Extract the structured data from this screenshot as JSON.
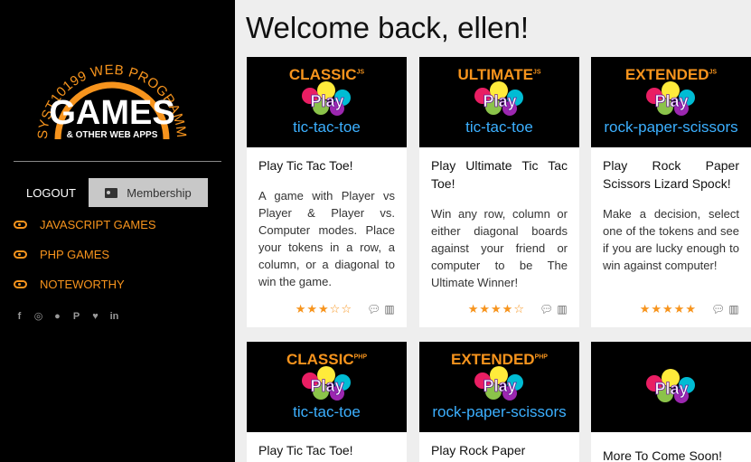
{
  "sidebar": {
    "logo": {
      "arc_text": "SYST10199 WEB PROGRAMMING",
      "title": "GAMES",
      "subtitle": "& OTHER WEB APPS"
    },
    "logout_label": "LOGOUT",
    "membership_label": "Membership",
    "nav": [
      {
        "label": "JAVASCRIPT GAMES",
        "icon": "gamepad-icon"
      },
      {
        "label": "PHP GAMES",
        "icon": "gamepad-icon"
      },
      {
        "label": "NOTEWORTHY",
        "icon": "gamepad-icon"
      }
    ],
    "social": [
      {
        "icon": "facebook-icon",
        "glyph": "f"
      },
      {
        "icon": "instagram-icon",
        "glyph": "◎"
      },
      {
        "icon": "snapchat-icon",
        "glyph": "●"
      },
      {
        "icon": "pinterest-icon",
        "glyph": "P"
      },
      {
        "icon": "twitter-icon",
        "glyph": "♥"
      },
      {
        "icon": "linkedin-icon",
        "glyph": "in"
      }
    ]
  },
  "main": {
    "welcome": "Welcome back, ellen!",
    "cards": [
      {
        "edition": "CLASSIC",
        "edition_sup": "JS",
        "subtitle": "tic-tac-toe",
        "title": "Play Tic Tac Toe!",
        "text": "A game with Player vs Player & Player vs. Computer modes. Place your tokens in a row, a column, or a diagonal to win the game.",
        "rating": 3.5,
        "stars": "★★★☆☆"
      },
      {
        "edition": "ULTIMATE",
        "edition_sup": "JS",
        "subtitle": "tic-tac-toe",
        "title": "Play Ultimate Tic Tac Toe!",
        "text": "Win any row, column or either diagonal boards against your friend or computer to be The Ultimate Winner!",
        "rating": 4,
        "stars": "★★★★☆"
      },
      {
        "edition": "EXTENDED",
        "edition_sup": "JS",
        "subtitle": "rock-paper-scissors",
        "title": "Play Rock Paper Scissors Lizard Spock!",
        "text": "Make a decision, select one of the tokens and see if you are lucky enough to win against computer!",
        "rating": 5,
        "stars": "★★★★★"
      },
      {
        "edition": "CLASSIC",
        "edition_sup": "PHP",
        "subtitle": "tic-tac-toe",
        "title": "Play Tic Tac Toe!"
      },
      {
        "edition": "EXTENDED",
        "edition_sup": "PHP",
        "subtitle": "rock-paper-scissors",
        "title": "Play Rock Paper"
      },
      {
        "edition": "",
        "edition_sup": "",
        "subtitle": "",
        "title": "More To Come Soon!"
      }
    ]
  },
  "colors": {
    "accent": "#f7941d",
    "link_blue": "#3cb0ff",
    "sidebar_bg": "#000000",
    "main_bg": "#eeeeee"
  }
}
